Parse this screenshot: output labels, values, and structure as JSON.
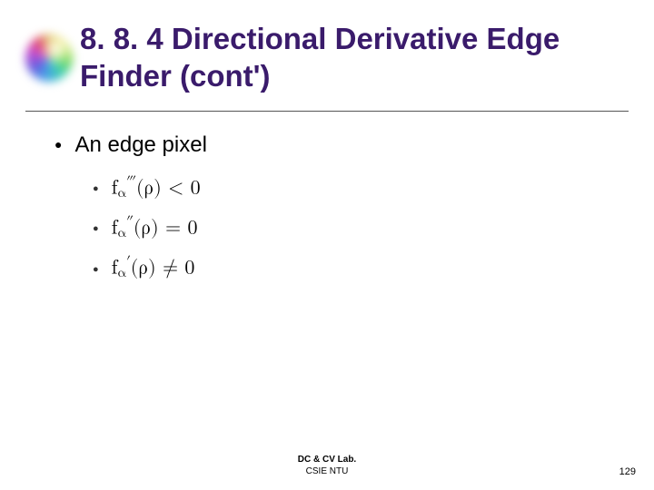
{
  "title": "8. 8. 4 Directional Derivative Edge Finder (cont')",
  "bullet_main": "An edge pixel",
  "eq1": {
    "func": "f",
    "sub": "α",
    "sup": "‴",
    "arg": "ρ",
    "rel": "<",
    "rhs": "0"
  },
  "eq2": {
    "func": "f",
    "sub": "α",
    "sup": "″",
    "arg": "ρ",
    "rel": "=",
    "rhs": "0"
  },
  "eq3": {
    "func": "f",
    "sub": "α",
    "sup": "′",
    "arg": "ρ",
    "rel": "≠",
    "rhs": "0"
  },
  "footer": {
    "line1": "DC & CV Lab.",
    "line2": "CSIE NTU"
  },
  "page_number": "129"
}
